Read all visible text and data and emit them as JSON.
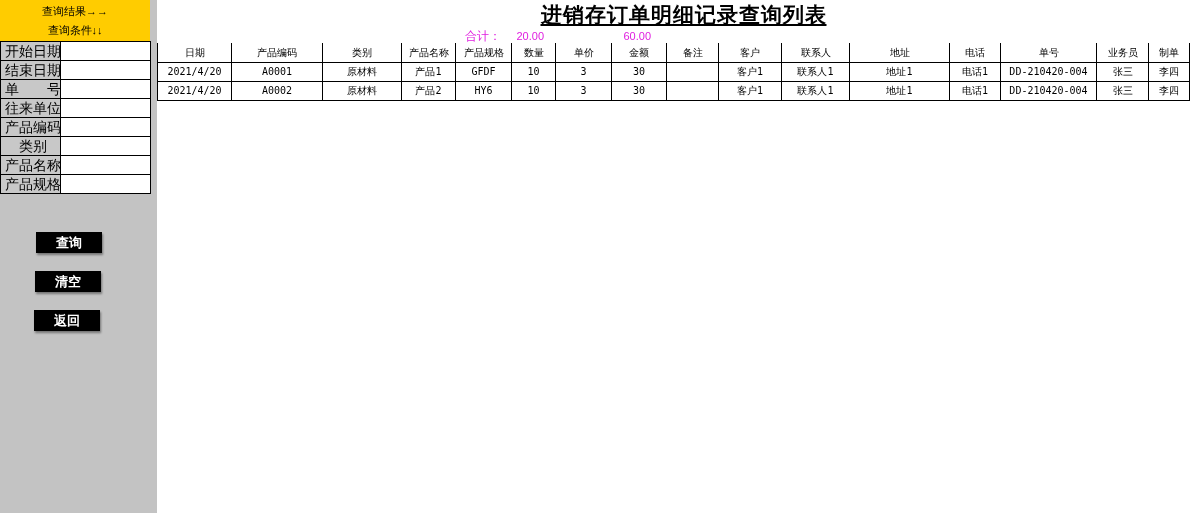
{
  "sidebar": {
    "header": [
      "查询结果→→",
      "查询条件↓↓"
    ],
    "fields": [
      {
        "label": "开始日期"
      },
      {
        "label": "结束日期"
      },
      {
        "label": "单　　号"
      },
      {
        "label": "往来单位"
      },
      {
        "label": "产品编码"
      },
      {
        "label": "　类别"
      },
      {
        "label": "产品名称"
      },
      {
        "label": "产品规格"
      }
    ],
    "buttons": [
      "查询",
      "清空",
      "返回"
    ]
  },
  "title": "进销存订单明细记录查询列表",
  "totals": {
    "label": "合计：",
    "quantity": "20.00",
    "amount": "60.00"
  },
  "table": {
    "columns": [
      "日期",
      "产品编码",
      "类别",
      "产品名称",
      "产品规格",
      "数量",
      "单价",
      "金额",
      "备注",
      "客户",
      "联系人",
      "地址",
      "电话",
      "单号",
      "业务员",
      "制单"
    ],
    "rows": [
      [
        "2021/4/20",
        "A0001",
        "原材料",
        "产品1",
        "GFDF",
        "10",
        "3",
        "30",
        "",
        "客户1",
        "联系人1",
        "地址1",
        "电话1",
        "DD-210420-004",
        "张三",
        "李四"
      ],
      [
        "2021/4/20",
        "A0002",
        "原材料",
        "产品2",
        "HY6",
        "10",
        "3",
        "30",
        "",
        "客户1",
        "联系人1",
        "地址1",
        "电话1",
        "DD-210420-004",
        "张三",
        "李四"
      ]
    ]
  }
}
